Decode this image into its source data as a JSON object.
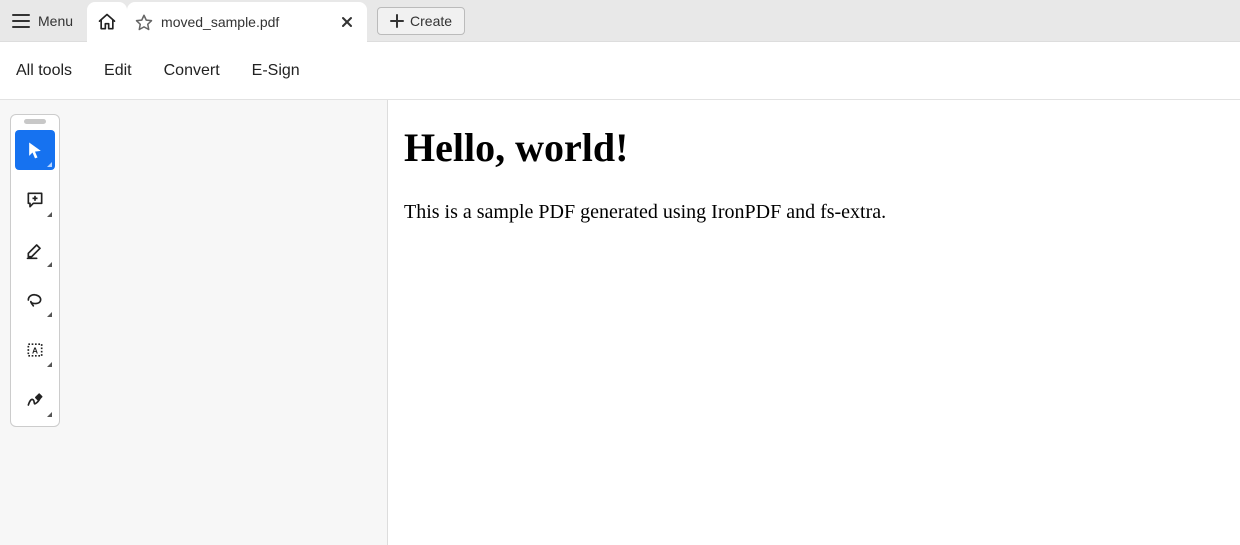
{
  "titlebar": {
    "menu_label": "Menu",
    "tab_label": "moved_sample.pdf",
    "create_label": "Create"
  },
  "menubar": {
    "items": [
      "All tools",
      "Edit",
      "Convert",
      "E-Sign"
    ]
  },
  "tools": {
    "items": [
      {
        "name": "select-tool",
        "active": true
      },
      {
        "name": "comment-tool",
        "active": false
      },
      {
        "name": "highlight-tool",
        "active": false
      },
      {
        "name": "draw-tool",
        "active": false
      },
      {
        "name": "textbox-tool",
        "active": false
      },
      {
        "name": "sign-tool",
        "active": false
      }
    ]
  },
  "document": {
    "heading": "Hello, world!",
    "body": "This is a sample PDF generated using IronPDF and fs-extra."
  }
}
